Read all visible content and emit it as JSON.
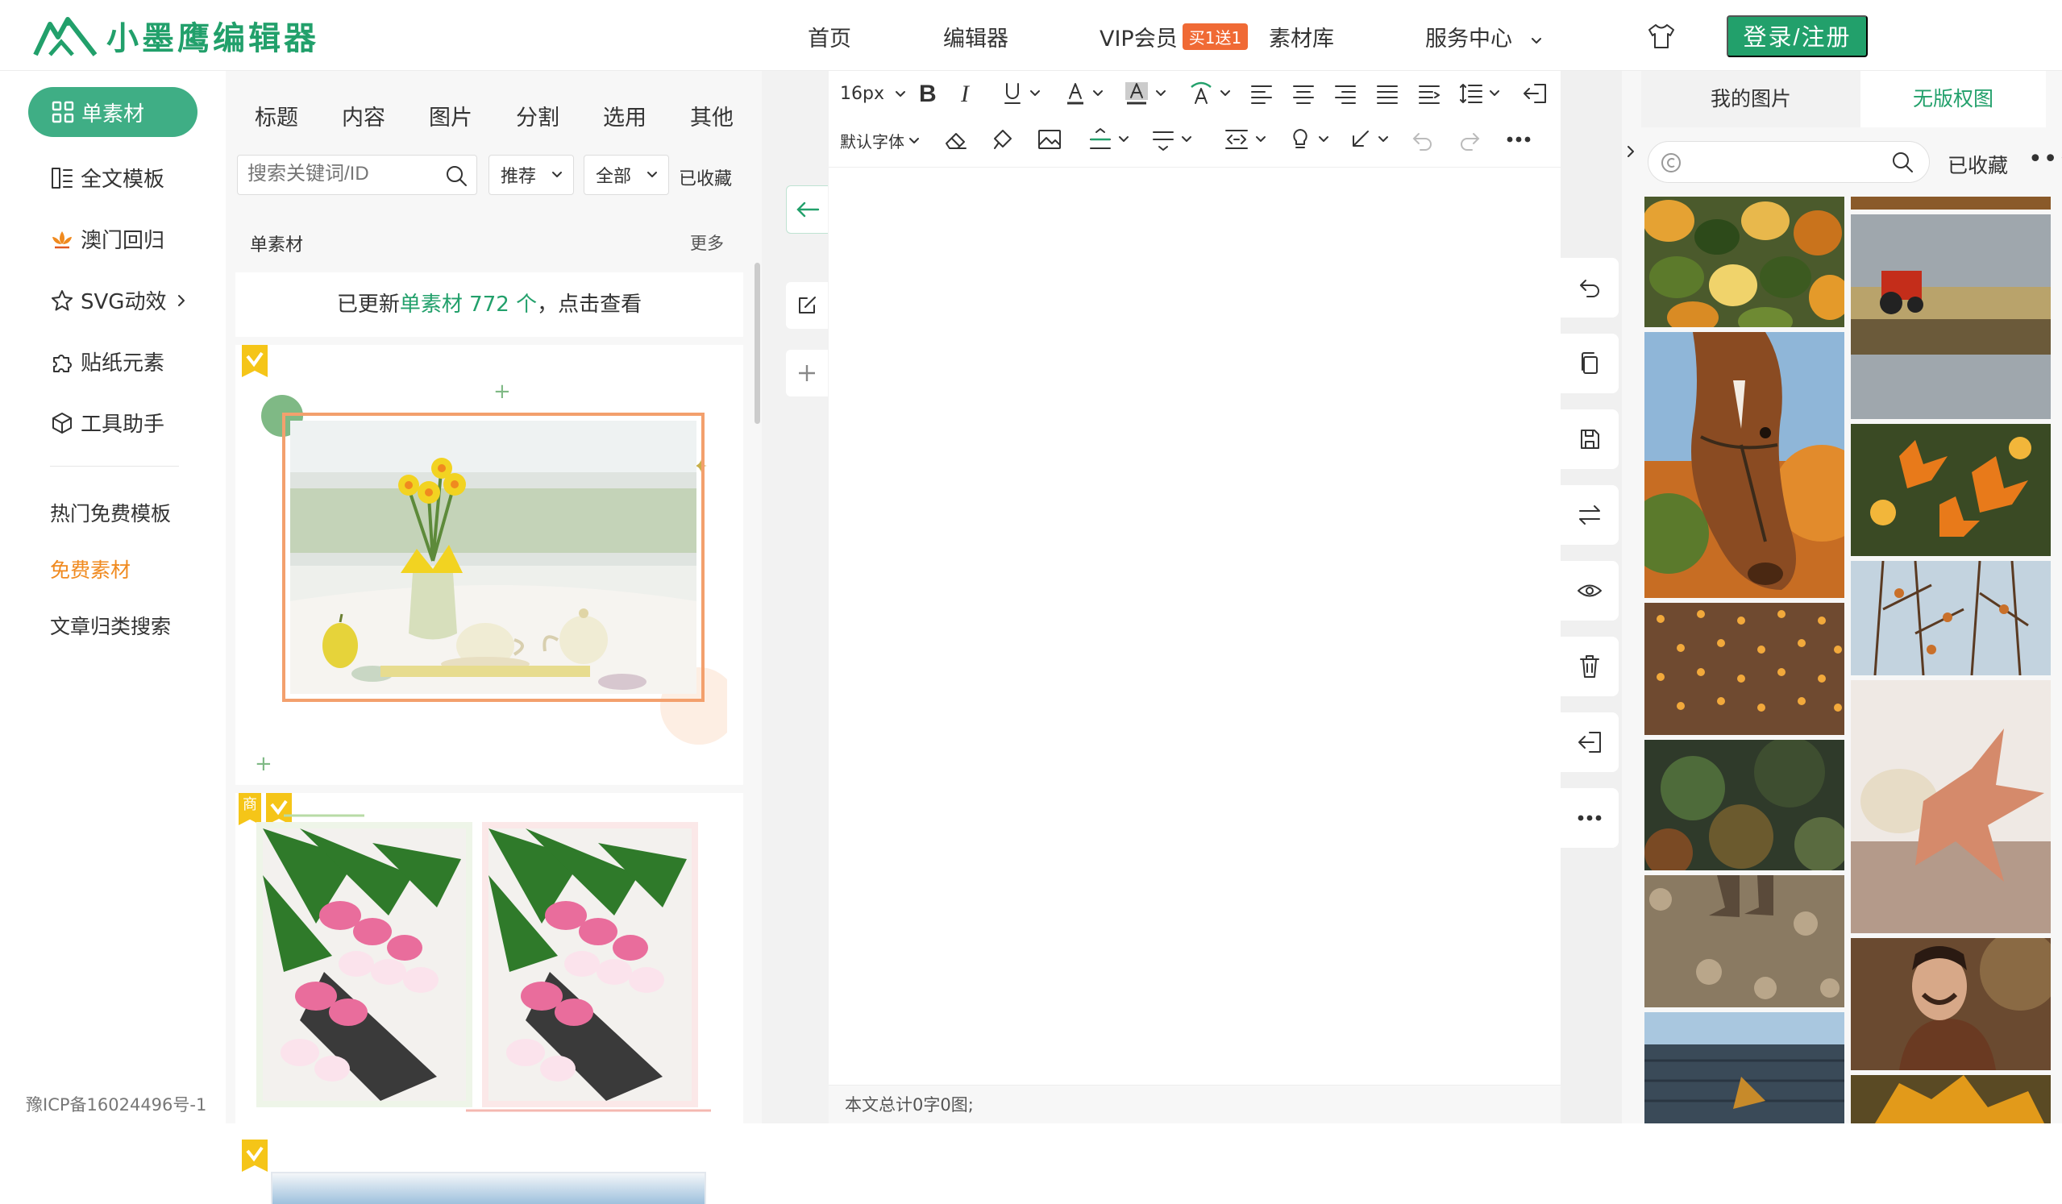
{
  "app": {
    "logo_text": "小墨鹰编辑器"
  },
  "topnav": {
    "home": "首页",
    "editor": "编辑器",
    "vip": "VIP会员",
    "vip_badge": "买1送1",
    "materials": "素材库",
    "service": "服务中心",
    "login": "登录/注册"
  },
  "leftnav": {
    "items": [
      "单素材",
      "全文模板",
      "澳门回归",
      "SVG动效",
      "贴纸元素",
      "工具助手"
    ],
    "sub": [
      "热门免费模板",
      "免费素材",
      "文章归类搜索"
    ],
    "icp": "豫ICP备16024496号-1"
  },
  "materials": {
    "tabs": [
      "标题",
      "内容",
      "图片",
      "分割",
      "选用",
      "其他"
    ],
    "search_placeholder": "搜索关键词/ID",
    "sort": "推荐",
    "filter": "全部",
    "collected": "已收藏",
    "section_title": "单素材",
    "more": "更多",
    "notice_pre": "已更新",
    "notice_hl": "单素材 772 个",
    "notice_post": "，点击查看",
    "badge_shop": "商"
  },
  "editor": {
    "font_size": "16px",
    "font_family": "默认字体",
    "status": "本文总计0字0图;"
  },
  "images": {
    "tab_mine": "我的图片",
    "tab_free": "无版权图",
    "search_placeholder": "",
    "favorites": "已收藏",
    "more": "•••"
  },
  "colors": {
    "brand": "#22a06b",
    "badge": "#f06a35",
    "highlight": "#f08a1f"
  }
}
